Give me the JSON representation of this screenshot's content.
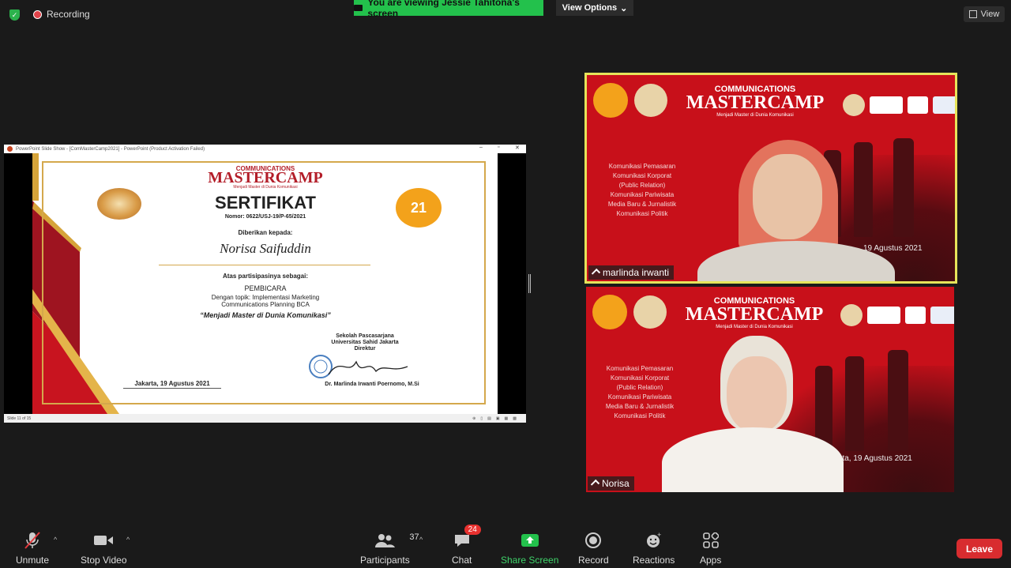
{
  "top": {
    "recording_label": "Recording",
    "banner_text": "You are viewing Jessie Tahitona's screen",
    "view_options_label": "View Options",
    "view_label": "View"
  },
  "shared_screen": {
    "window_title": "PowerPoint Slide Show - [ComMasterCamp2021] - PowerPoint (Product Activation Failed)",
    "status_text": "Slide 11 of 15",
    "certificate": {
      "brand_top": "COMMUNICATIONS",
      "brand_main": "MASTERCAMP",
      "brand_sub": "Menjadi Master di Dunia Komunikasi",
      "heading": "SERTIFIKAT",
      "number": "Nomor: 0622/USJ-19/P-65/2021",
      "given_to": "Diberikan kepada:",
      "recipient": "Norisa Saifuddin",
      "participation": "Atas partisipasinya sebagai:",
      "role": "PEMBICARA",
      "topic_line1": "Dengan topik: Implementasi Marketing",
      "topic_line2": "Communications Planning BCA",
      "tagline": "“Menjadi Master di Dunia Komunikasi”",
      "school_line1": "Sekolah Pascasarjana",
      "school_line2": "Universitas Sahid Jakarta",
      "school_line3": "Direktur",
      "place_date": "Jakarta, 19 Agustus 2021",
      "signer": "Dr. Marlinda Irwanti Poernomo, M.Si",
      "badge_number": "21"
    }
  },
  "participants": [
    {
      "name": "marlinda irwanti",
      "bg_brand_top": "COMMUNICATIONS",
      "bg_brand_main": "MASTERCAMP",
      "bg_sub": "Menjadi Master di Dunia Komunikasi",
      "bg_topics": [
        "Komunikasi Pemasaran",
        "Komunikasi Korporat",
        "(Public Relation)",
        "Komunikasi Pariwisata",
        "Media Baru & Jurnalistik",
        "Komunikasi Politik"
      ],
      "bg_date": "19 Agustus 2021"
    },
    {
      "name": "Norisa",
      "bg_brand_top": "COMMUNICATIONS",
      "bg_brand_main": "MASTERCAMP",
      "bg_sub": "Menjadi Master di Dunia Komunikasi",
      "bg_topics": [
        "Komunikasi Pemasaran",
        "Komunikasi Korporat",
        "(Public Relation)",
        "Komunikasi Pariwisata",
        "Media Baru & Jurnalistik",
        "Komunikasi Politik"
      ],
      "bg_date": "Jakarta, 19 Agustus 2021"
    }
  ],
  "toolbar": {
    "unmute": "Unmute",
    "stop_video": "Stop Video",
    "participants": "Participants",
    "participants_count": "37",
    "chat": "Chat",
    "chat_badge": "24",
    "share_screen": "Share Screen",
    "record": "Record",
    "reactions": "Reactions",
    "apps": "Apps",
    "leave": "Leave"
  },
  "colors": {
    "banner_green": "#23c14c",
    "active_speaker_border": "#e6e35a",
    "leave_red": "#d82c2f",
    "share_green": "#23c14c"
  }
}
